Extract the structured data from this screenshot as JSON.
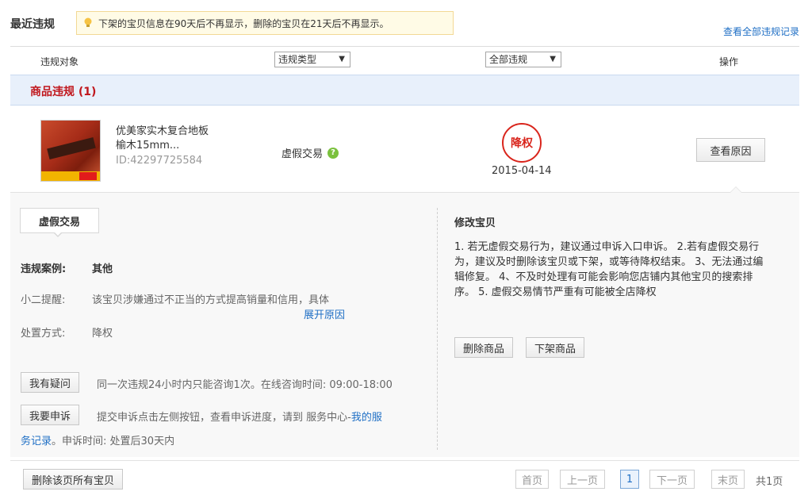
{
  "header": {
    "title": "最近违规",
    "notice": "下架的宝贝信息在90天后不再显示，删除的宝贝在21天后不再显示。",
    "view_all_link": "查看全部违规记录"
  },
  "columns": {
    "object": "违规对象",
    "type_select": "违规类型",
    "filter_select": "全部违规",
    "action": "操作"
  },
  "category": {
    "label": "商品违规 (1)"
  },
  "item": {
    "name_line1": "优美家实木复合地板",
    "name_line2": "榆木15mm...",
    "id": "ID:42297725584",
    "violation_type": "虚假交易",
    "penalty": "降权",
    "date": "2015-04-14",
    "reason_button": "查看原因"
  },
  "detail": {
    "tag": "虚假交易",
    "case_label": "违规案例:",
    "case_value": "其他",
    "tip_label": "小二提醒:",
    "tip_text": "该宝贝涉嫌通过不正当的方式提高销量和信用，具体",
    "expand_link": "展开原因",
    "handling_label": "处置方式:",
    "handling_value": "降权",
    "question_button": "我有疑问",
    "question_text": "同一次违规24小时内只能咨询1次。在线咨询时间: 09:00-18:00",
    "appeal_button": "我要申诉",
    "appeal_text": "提交申诉点击左侧按钮，查看申诉进度，请到 服务中心-",
    "appeal_link_part1": "我的服",
    "appeal_link_part2": "务记录",
    "appeal_suffix": "。申诉时间: 处置后30天内",
    "fix_title": "修改宝贝",
    "fix_text": "1. 若无虚假交易行为，建议通过申诉入口申诉。 2.若有虚假交易行为，建议及时删除该宝贝或下架，或等待降权结束。 3、无法通过编辑修复。 4、不及时处理有可能会影响您店铺内其他宝贝的搜索排序。 5. 虚假交易情节严重有可能被全店降权",
    "delete_button": "删除商品",
    "offshelf_button": "下架商品"
  },
  "footer": {
    "delete_all_button": "删除该页所有宝贝",
    "first": "首页",
    "prev": "上一页",
    "current": "1",
    "next": "下一页",
    "last": "末页",
    "total": "共1页"
  },
  "colors": {
    "link": "#1f6fc5",
    "danger": "#c0171d",
    "band": "#e8f0fb",
    "notice_bg": "#fffbe6"
  }
}
